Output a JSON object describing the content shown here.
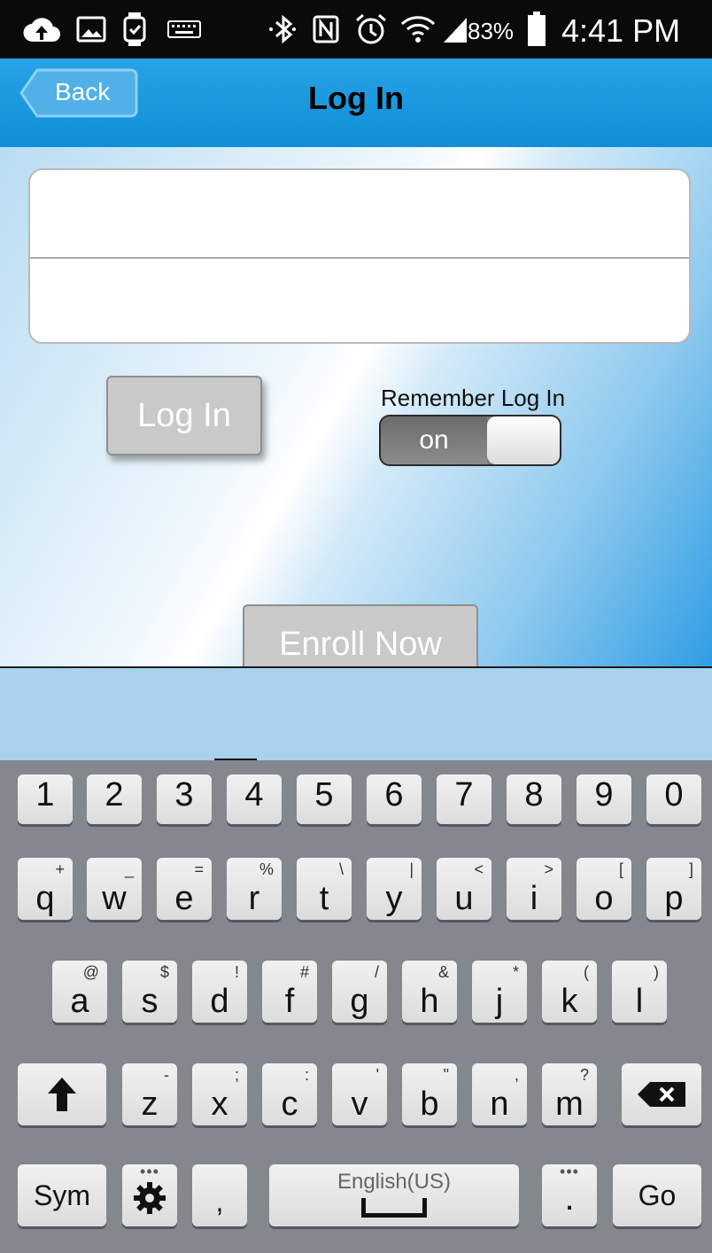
{
  "status_bar": {
    "battery_percent": "83%",
    "time": "4:41 PM",
    "icons": [
      "cloud-upload-icon",
      "image-icon",
      "watch-icon",
      "keyboard-icon",
      "bluetooth-icon",
      "nfc-icon",
      "alarm-icon",
      "wifi-icon",
      "signal-icon",
      "battery-icon"
    ]
  },
  "nav": {
    "back_label": "Back",
    "title": "Log In"
  },
  "form": {
    "username_value": "",
    "password_value": "",
    "login_label": "Log In",
    "remember_label": "Remember Log In",
    "toggle_state": "on",
    "enroll_label": "Enroll Now"
  },
  "keyboard": {
    "number_row": [
      "1",
      "2",
      "3",
      "4",
      "5",
      "6",
      "7",
      "8",
      "9",
      "0"
    ],
    "row1": {
      "keys": [
        "q",
        "w",
        "e",
        "r",
        "t",
        "y",
        "u",
        "i",
        "o",
        "p"
      ],
      "alts": [
        "+",
        "_",
        "=",
        "%",
        "\\",
        "|",
        "<",
        ">",
        "[",
        "]"
      ]
    },
    "row2": {
      "keys": [
        "a",
        "s",
        "d",
        "f",
        "g",
        "h",
        "j",
        "k",
        "l"
      ],
      "alts": [
        "@",
        "$",
        "!",
        "#",
        "/",
        "&",
        "*",
        "(",
        ")"
      ]
    },
    "row3": {
      "keys": [
        "z",
        "x",
        "c",
        "v",
        "b",
        "n",
        "m"
      ],
      "alts": [
        "-",
        ";",
        ":",
        "'",
        "\"",
        ",",
        "?"
      ]
    },
    "sym_label": "Sym",
    "comma_label": ",",
    "space_label": "English(US)",
    "period_label": ".",
    "go_label": "Go"
  },
  "colors": {
    "nav_blue": "#1b9ce0",
    "keyboard_bg": "#84878d",
    "button_gray": "#c9c9c9"
  }
}
